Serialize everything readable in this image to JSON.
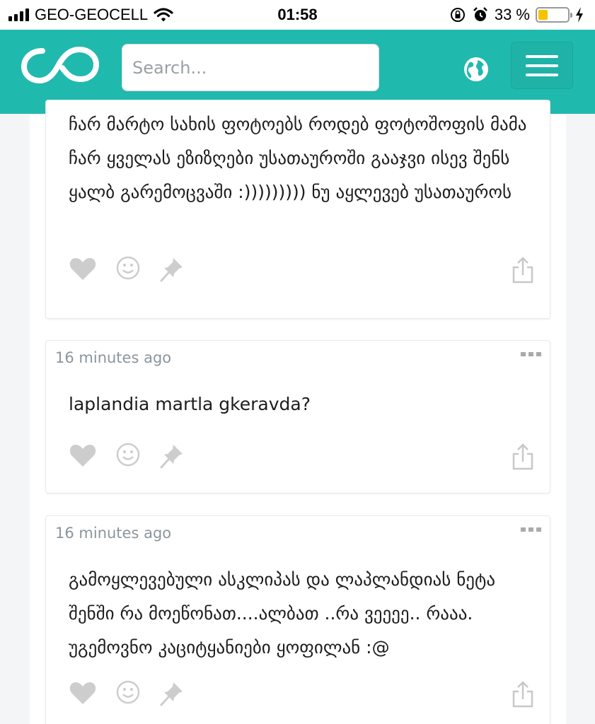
{
  "status_bar": {
    "carrier": "GEO-GEOCELL",
    "time": "01:58",
    "battery_percent": "33 %",
    "battery_level": 0.33
  },
  "header": {
    "search_placeholder": "Search...",
    "accent_color": "#20b9ae",
    "icons": [
      "infinity-logo-icon",
      "globe-icon",
      "menu-icon"
    ]
  },
  "posts": [
    {
      "time": "",
      "text": "ჩარ მარტო სახის ფოტოებს როდებ ფოტოშოფის მამა ჩარ ყველას ეზიზღები უსათაუროში გააჯვი ისევ შენს ყალბ გარემოცვაში :))))))))) ნუ აყლევებ უსათაუროს"
    },
    {
      "time": "16 minutes ago",
      "text": "laplandia martla gkeravda?"
    },
    {
      "time": "16 minutes ago",
      "text": "გამოყლევებული ასკლიპას და ლაპლანდიას ნეტა შენში რა მოეწონათ....ალბათ ..რა ვეეეე.. რააა. უგემოვნო კაციტყანიები ყოფილან :@"
    }
  ],
  "action_icons": [
    "heart-icon",
    "smile-icon",
    "pin-icon",
    "share-icon"
  ]
}
